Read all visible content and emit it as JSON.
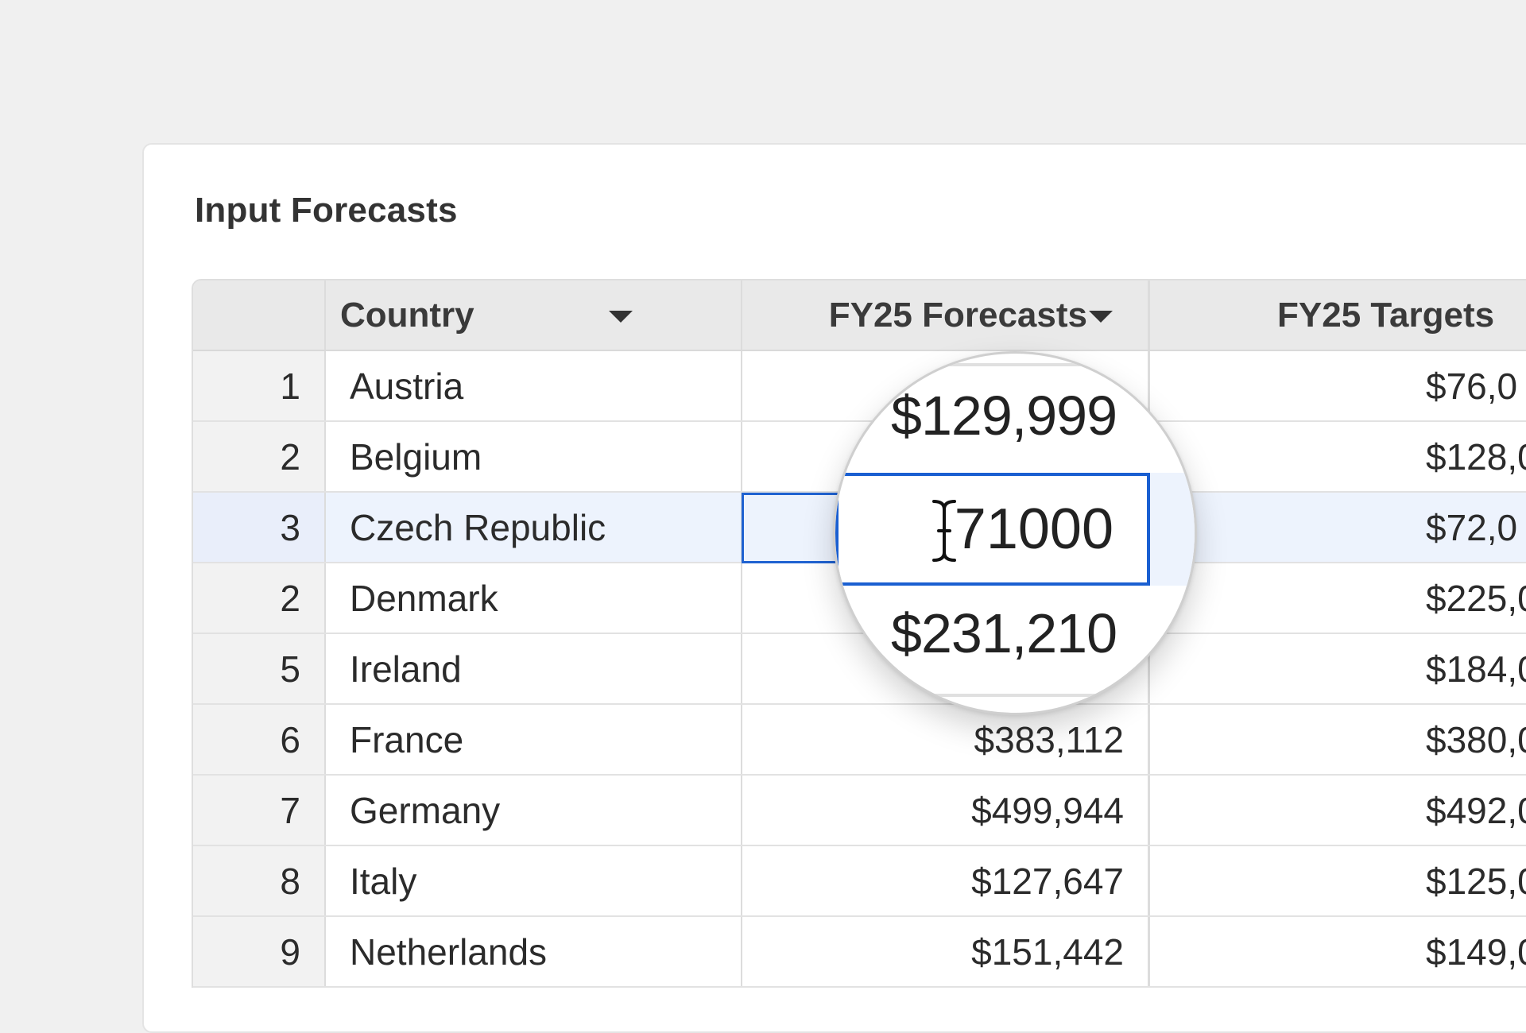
{
  "panel": {
    "title": "Input Forecasts"
  },
  "table": {
    "columns": {
      "index": "",
      "country": "Country",
      "forecasts": "FY25 Forecasts",
      "targets": "FY25 Targets"
    },
    "rows": [
      {
        "index": "1",
        "country": "Austria",
        "forecast": "",
        "target": "$76,0"
      },
      {
        "index": "2",
        "country": "Belgium",
        "forecast": "",
        "target": "$128,0"
      },
      {
        "index": "3",
        "country": "Czech Republic",
        "forecast": "",
        "target": "$72,0",
        "selected": true
      },
      {
        "index": "2",
        "country": "Denmark",
        "forecast": "",
        "target": "$225,0"
      },
      {
        "index": "5",
        "country": "Ireland",
        "forecast": "",
        "target": "$184,0"
      },
      {
        "index": "6",
        "country": "France",
        "forecast": "$383,112",
        "target": "$380,0"
      },
      {
        "index": "7",
        "country": "Germany",
        "forecast": "$499,944",
        "target": "$492,0"
      },
      {
        "index": "8",
        "country": "Italy",
        "forecast": "$127,647",
        "target": "$125,0"
      },
      {
        "index": "9",
        "country": "Netherlands",
        "forecast": "$151,442",
        "target": "$149,0"
      }
    ]
  },
  "magnifier": {
    "above_value": "$129,999",
    "editing_value": "71000",
    "below_value": "$231,210"
  },
  "colors": {
    "selection_border": "#1f62d1",
    "selected_row_bg": "#edf3fd",
    "header_bg": "#e9e9e9"
  },
  "icons": {
    "sort": "caret-down-icon",
    "cursor": "text-cursor-icon"
  }
}
